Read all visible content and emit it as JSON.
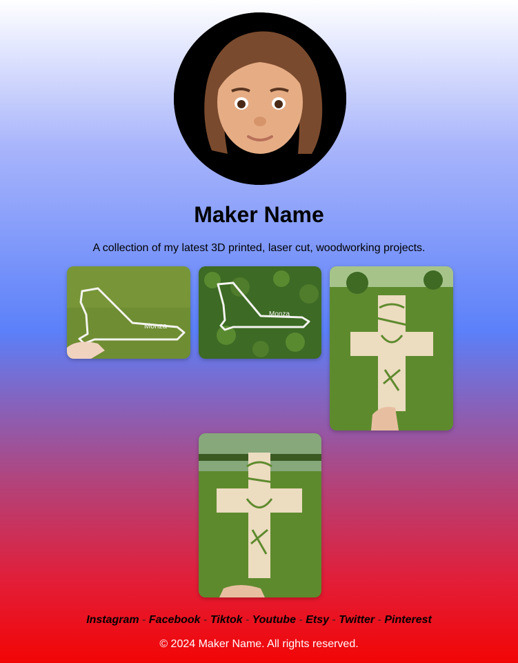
{
  "profile": {
    "name": "Maker Name",
    "tagline": "A collection of my latest 3D printed, laser cut, woodworking projects."
  },
  "gallery": [
    {
      "caption": "Monza"
    },
    {
      "caption": "Monza"
    },
    {
      "caption": ""
    },
    {
      "caption": ""
    }
  ],
  "social": {
    "links": [
      "Instagram",
      "Facebook",
      "Tiktok",
      "Youtube",
      "Etsy",
      "Twitter",
      "Pinterest"
    ],
    "separator": "-"
  },
  "footer": {
    "copyright": "© 2024 Maker Name. All rights reserved."
  },
  "colors": {
    "gradient_top": "#ffffff",
    "gradient_mid": "#5b80f9",
    "gradient_bottom": "#f20505"
  }
}
